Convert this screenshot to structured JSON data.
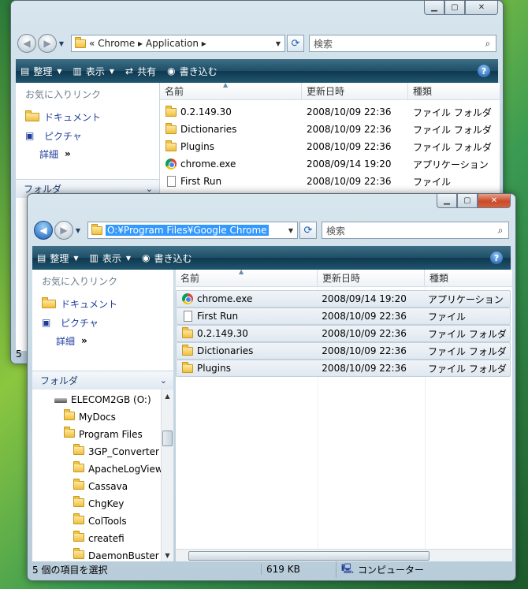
{
  "back_window": {
    "address_path": "« Chrome ▸ Application ▸",
    "search_placeholder": "検索",
    "toolbar": {
      "organize": "整理",
      "views": "表示",
      "share": "共有",
      "burn": "書き込む",
      "help": "?"
    },
    "favorites_title": "お気に入りリンク",
    "links": [
      "ドキュメント",
      "ピクチャ"
    ],
    "more_label": "詳細",
    "folders_label": "フォルダ",
    "columns": {
      "name": "名前",
      "modified": "更新日時",
      "type": "種類"
    },
    "files": [
      {
        "name": "0.2.149.30",
        "modified": "2008/10/09 22:36",
        "type": "ファイル フォルダ",
        "icon": "folder-icon"
      },
      {
        "name": "Dictionaries",
        "modified": "2008/10/09 22:36",
        "type": "ファイル フォルダ",
        "icon": "folder-icon"
      },
      {
        "name": "Plugins",
        "modified": "2008/10/09 22:36",
        "type": "ファイル フォルダ",
        "icon": "folder-icon"
      },
      {
        "name": "chrome.exe",
        "modified": "2008/09/14 19:20",
        "type": "アプリケーション",
        "icon": "chrome-icon"
      },
      {
        "name": "First Run",
        "modified": "2008/10/09 22:36",
        "type": "ファイル",
        "icon": "file-icon"
      }
    ],
    "status_fragment": "5"
  },
  "front_window": {
    "address_path": "O:¥Program Files¥Google Chrome",
    "search_placeholder": "検索",
    "toolbar": {
      "organize": "整理",
      "views": "表示",
      "burn": "書き込む",
      "help": "?"
    },
    "favorites_title": "お気に入りリンク",
    "links": [
      "ドキュメント",
      "ピクチャ"
    ],
    "more_label": "詳細",
    "folders_label": "フォルダ",
    "tree": [
      {
        "label": "ELECOM2GB (O:)",
        "icon": "drive-icon",
        "level": 0
      },
      {
        "label": "MyDocs",
        "icon": "folder-icon",
        "level": 1
      },
      {
        "label": "Program Files",
        "icon": "folder-icon",
        "level": 1
      },
      {
        "label": "3GP_Converter",
        "icon": "folder-icon",
        "level": 2
      },
      {
        "label": "ApacheLogViewer",
        "icon": "folder-icon",
        "level": 2
      },
      {
        "label": "Cassava",
        "icon": "folder-icon",
        "level": 2
      },
      {
        "label": "ChgKey",
        "icon": "folder-icon",
        "level": 2
      },
      {
        "label": "ColTools",
        "icon": "folder-icon",
        "level": 2
      },
      {
        "label": "createfi",
        "icon": "folder-icon",
        "level": 2
      },
      {
        "label": "DaemonBuster",
        "icon": "folder-icon",
        "level": 2
      }
    ],
    "columns": {
      "name": "名前",
      "modified": "更新日時",
      "type": "種類"
    },
    "files": [
      {
        "name": "chrome.exe",
        "modified": "2008/09/14 19:20",
        "type": "アプリケーション",
        "icon": "chrome-icon"
      },
      {
        "name": "First Run",
        "modified": "2008/10/09 22:36",
        "type": "ファイル",
        "icon": "file-icon"
      },
      {
        "name": "0.2.149.30",
        "modified": "2008/10/09 22:36",
        "type": "ファイル フォルダ",
        "icon": "folder-icon"
      },
      {
        "name": "Dictionaries",
        "modified": "2008/10/09 22:36",
        "type": "ファイル フォルダ",
        "icon": "folder-icon"
      },
      {
        "name": "Plugins",
        "modified": "2008/10/09 22:36",
        "type": "ファイル フォルダ",
        "icon": "folder-icon"
      }
    ],
    "status": {
      "selection": "5 個の項目を選択",
      "size": "619 KB",
      "location": "コンピューター"
    }
  }
}
